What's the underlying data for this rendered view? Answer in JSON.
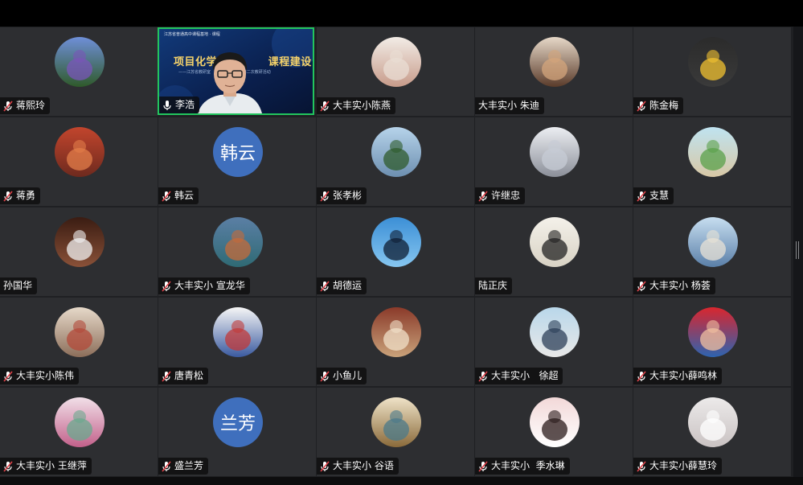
{
  "participants": [
    {
      "name": "蒋熙玲",
      "avatar_icon": "mountain-flowers-photo",
      "muted": true
    },
    {
      "name": "李浩",
      "avatar_icon": "speaker-video",
      "muted": false,
      "active_speaker": true
    },
    {
      "name": "大丰实小陈燕",
      "avatar_icon": "dancer-photo",
      "muted": true
    },
    {
      "name": "大丰实小 朱迪",
      "avatar_icon": "child-photo",
      "muted": null
    },
    {
      "name": "陈金梅",
      "avatar_icon": "cartoon-bee-photo",
      "muted": true
    },
    {
      "name": "蒋勇",
      "avatar_icon": "koi-fish-photo",
      "muted": true
    },
    {
      "name": "韩云",
      "avatar_text": "韩云",
      "muted": true
    },
    {
      "name": "张孝彬",
      "avatar_icon": "trees-sky-photo",
      "muted": true
    },
    {
      "name": "许继忠",
      "avatar_icon": "couple-snow-photo",
      "muted": true
    },
    {
      "name": "支慧",
      "avatar_icon": "green-road-photo",
      "muted": true
    },
    {
      "name": "孙国华",
      "avatar_icon": "man-portrait-photo",
      "muted": null
    },
    {
      "name": "大丰实小 宣龙华",
      "avatar_icon": "coastal-landscape-photo",
      "muted": true
    },
    {
      "name": "胡德运",
      "avatar_icon": "hiker-silhouette-photo",
      "muted": true
    },
    {
      "name": "陆正庆",
      "avatar_icon": "calligraphy-photo",
      "muted": null
    },
    {
      "name": "大丰实小 杨荟",
      "avatar_icon": "beach-family-photo",
      "muted": true
    },
    {
      "name": "大丰实小陈伟",
      "avatar_icon": "sketch-art-photo",
      "muted": true
    },
    {
      "name": "唐青松",
      "avatar_icon": "cartoon-rider-photo",
      "muted": true
    },
    {
      "name": "小鱼儿",
      "avatar_icon": "book-pages-photo",
      "muted": true
    },
    {
      "name": "大丰实小   徐超",
      "avatar_icon": "lit-corridor-photo",
      "muted": true
    },
    {
      "name": "大丰实小薛鸣林",
      "avatar_icon": "red-cartoon-photo",
      "muted": true
    },
    {
      "name": "大丰实小 王继萍",
      "avatar_icon": "blossom-painting-photo",
      "muted": true
    },
    {
      "name": "盛兰芳",
      "avatar_text": "兰芳",
      "muted": true
    },
    {
      "name": "大丰实小 谷语",
      "avatar_icon": "girl-umbrella-photo",
      "muted": true
    },
    {
      "name": "大丰实小  季水琳",
      "avatar_icon": "glasses-girl-cartoon",
      "muted": true
    },
    {
      "name": "大丰实小薛慧玲",
      "avatar_icon": "bear-cartoon-photo",
      "muted": true
    }
  ],
  "video_banner": {
    "org": "江苏省普通高中课程基地 · 课程",
    "title": "项目化学习          课程建设",
    "subtitle": "——江苏省教研室                         第二次教研活动"
  },
  "controls": {
    "prev_icon": "chevron-left-icon",
    "next_icon": "chevron-right-icon",
    "list_icon": "list-icon"
  },
  "colors": {
    "active_border": "#22c55e",
    "muted_mic": "#e0434a",
    "text_avatar_bg": "#3f6fbd"
  }
}
